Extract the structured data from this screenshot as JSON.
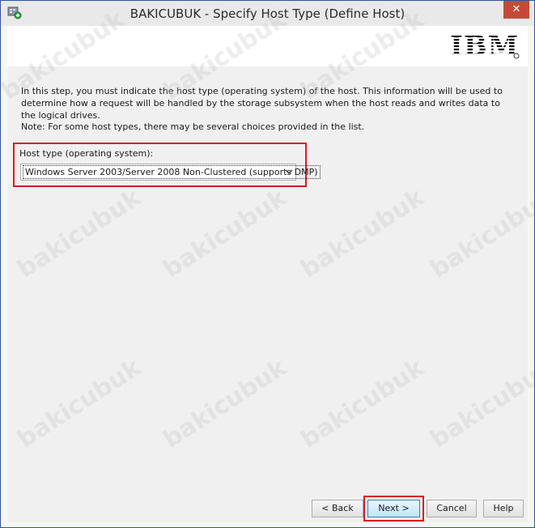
{
  "window": {
    "title": "BAKICUBUK - Specify Host Type (Define Host)",
    "close_glyph": "✕",
    "accent_color": "#2b5797",
    "close_color": "#c7483a"
  },
  "header": {
    "logo_text": "IBM"
  },
  "main": {
    "description": "In this step, you must indicate the host type (operating system) of the host. This information will be used to determine how a request will be handled by the storage subsystem when the host reads and writes data to the logical drives.",
    "note": "Note: For some host types, there may be several choices provided in the list.",
    "host_type_label": "Host type (operating system):",
    "host_type_selected": "Windows Server 2003/Server 2008 Non-Clustered (supports DMP)",
    "highlight_color": "#d71b27"
  },
  "footer": {
    "back_label": "< Back",
    "next_label": "Next >",
    "cancel_label": "Cancel",
    "help_label": "Help"
  },
  "watermark": {
    "text": "bakicubuk"
  }
}
